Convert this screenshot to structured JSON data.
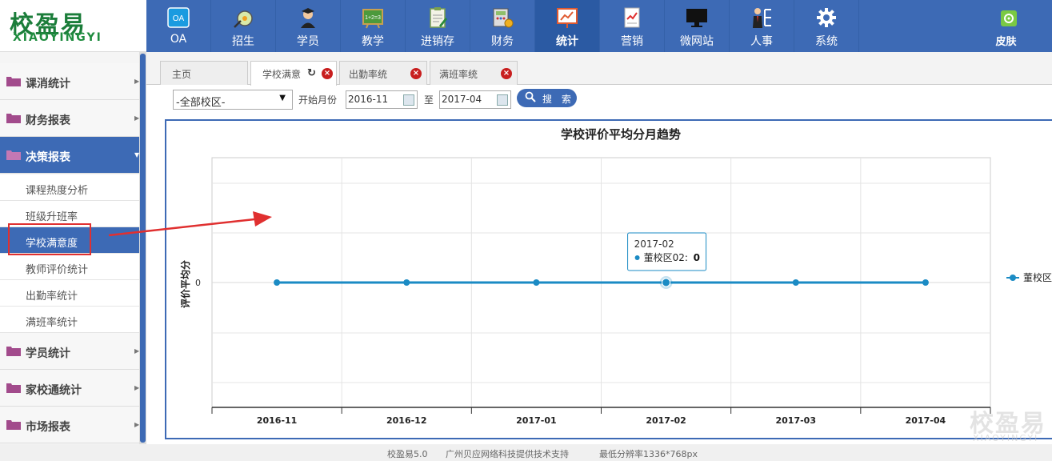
{
  "logo": {
    "cn": "校盈易",
    "en": "XIAOYINGYI"
  },
  "nav": [
    {
      "label": "OA",
      "icon": "oa-icon"
    },
    {
      "label": "招生",
      "icon": "enrollment-icon"
    },
    {
      "label": "学员",
      "icon": "student-icon"
    },
    {
      "label": "教学",
      "icon": "teaching-icon"
    },
    {
      "label": "进销存",
      "icon": "inventory-icon"
    },
    {
      "label": "财务",
      "icon": "finance-icon"
    },
    {
      "label": "统计",
      "icon": "statistics-icon"
    },
    {
      "label": "营销",
      "icon": "marketing-icon"
    },
    {
      "label": "微网站",
      "icon": "monitor-icon"
    },
    {
      "label": "人事",
      "icon": "personnel-icon"
    },
    {
      "label": "系统",
      "icon": "gear-icon"
    }
  ],
  "skin": {
    "label": "皮肤"
  },
  "sidebar": {
    "groups": [
      {
        "label": "课消统计"
      },
      {
        "label": "财务报表"
      },
      {
        "label": "决策报表"
      },
      {
        "label": "学员统计"
      },
      {
        "label": "家校通统计"
      },
      {
        "label": "市场报表"
      }
    ],
    "sub_items": [
      {
        "label": "课程热度分析"
      },
      {
        "label": "班级升班率"
      },
      {
        "label": "学校满意度"
      },
      {
        "label": "教师评价统计"
      },
      {
        "label": "出勤率统计"
      },
      {
        "label": "满班率统计"
      }
    ]
  },
  "tabs": [
    {
      "label": "主页"
    },
    {
      "label": "学校满意"
    },
    {
      "label": "出勤率统"
    },
    {
      "label": "满班率统"
    }
  ],
  "filter": {
    "campus": "-全部校区-",
    "start_label": "开始月份",
    "start": "2016-11",
    "to_label": "至",
    "end": "2017-04",
    "search_label": "搜 索"
  },
  "chart_data": {
    "type": "line",
    "title": "学校评价平均分月趋势",
    "ylabel": "评价平均分",
    "categories": [
      "2016-11",
      "2016-12",
      "2017-01",
      "2017-02",
      "2017-03",
      "2017-04"
    ],
    "y_ticks": [
      "0"
    ],
    "series": [
      {
        "name": "董校区02",
        "values": [
          0,
          0,
          0,
          0,
          0,
          0
        ],
        "color": "#1b8bc4"
      }
    ],
    "legend_label": "董校区",
    "legend": "right",
    "grid": true,
    "tooltip": {
      "category": "2017-02",
      "series": "董校区02",
      "value": "0"
    }
  },
  "footer": {
    "product": "校盈易5.0",
    "support": "广州贝应网络科技提供技术支持",
    "resolution": "最低分辨率1336*768px"
  },
  "colors": {
    "brand": "#3d6ab5",
    "accent": "#1b8bc4",
    "logo": "#1b7d3a",
    "close": "#c81e1e"
  }
}
